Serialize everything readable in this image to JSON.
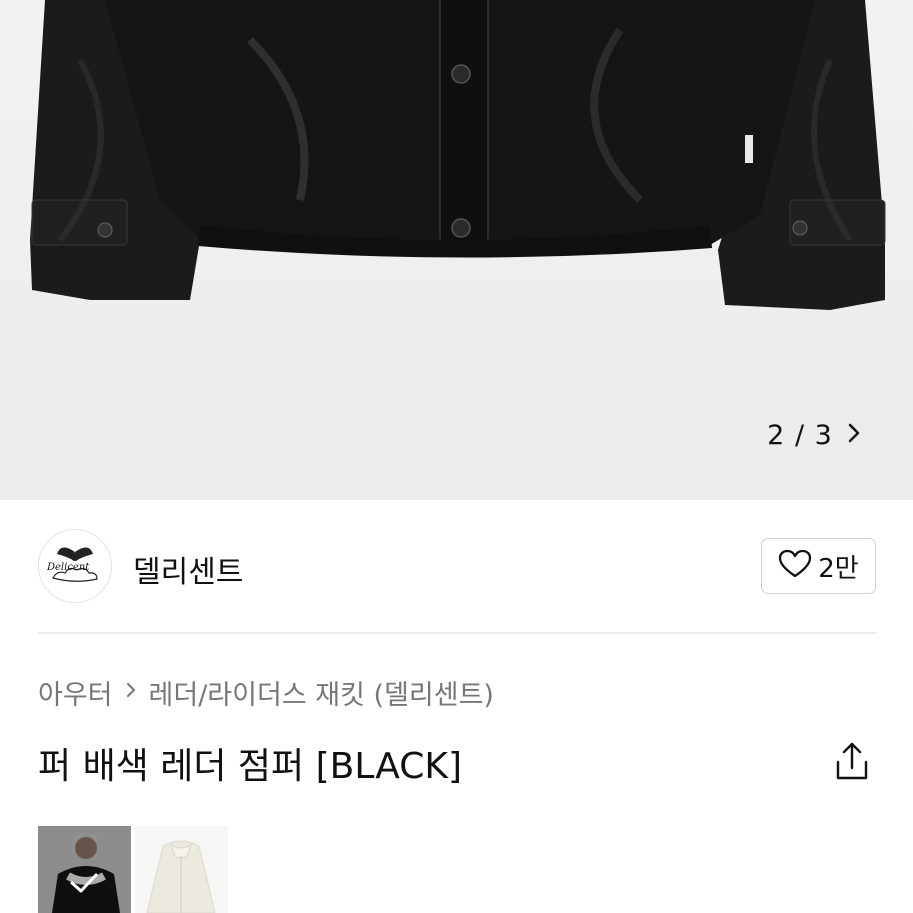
{
  "gallery": {
    "current": "2",
    "separator": "/",
    "total": "3",
    "next_icon": "chevron-right-icon"
  },
  "brand": {
    "name": "델리센트",
    "logo_text": "Delicent",
    "like_count": "2만",
    "like_icon": "heart-outline-icon"
  },
  "breadcrumb": {
    "items": [
      "아우터",
      "레더/라이더스 재킷 (델리센트)"
    ],
    "separator_icon": "chevron-right-icon"
  },
  "product": {
    "title": "퍼 배색 레더 점퍼 [BLACK]",
    "share_icon": "share-icon"
  },
  "colors": {
    "hero_bg": "#efefef",
    "divider": "#ececec",
    "text_primary": "#111111",
    "text_secondary": "#777777"
  }
}
